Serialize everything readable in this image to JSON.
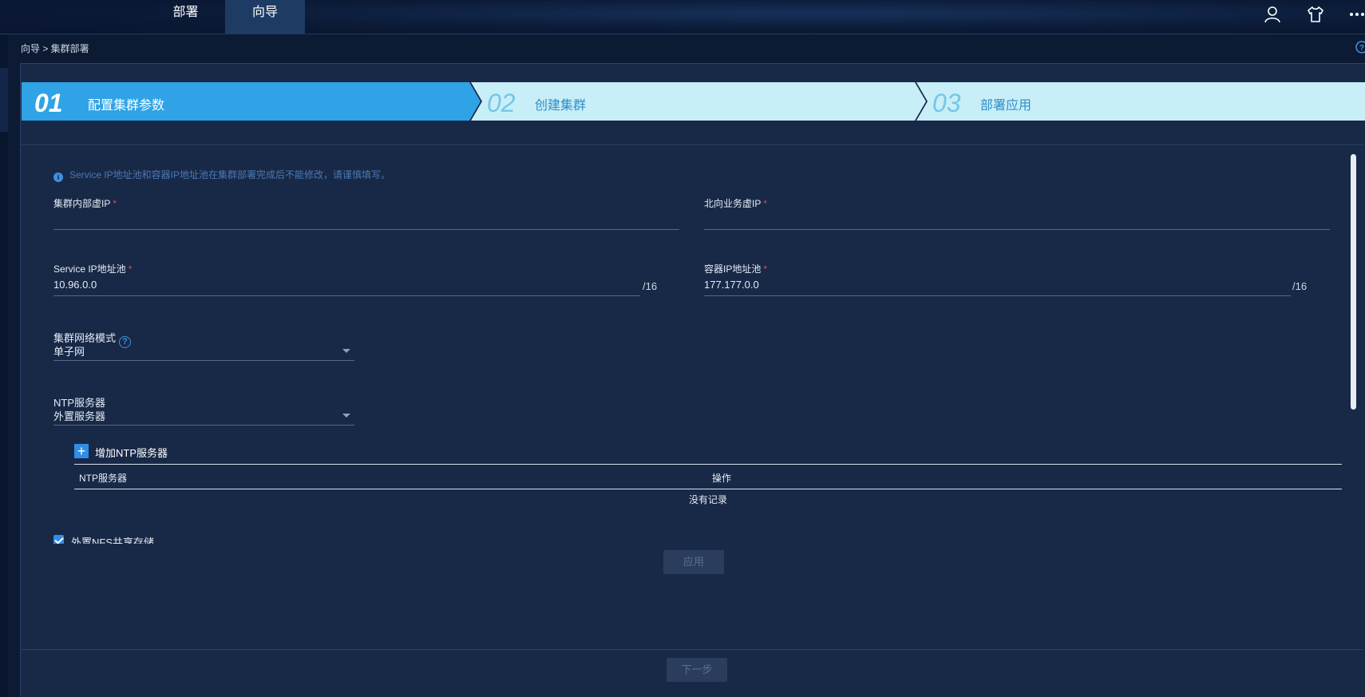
{
  "topbar": {
    "tabs": [
      {
        "label": "部署",
        "active": false
      },
      {
        "label": "向导",
        "active": true
      }
    ],
    "icons": [
      "user-icon",
      "theme-shirt-icon",
      "more-icon"
    ]
  },
  "breadcrumb": {
    "text": "向导 > 集群部署"
  },
  "steps": [
    {
      "number": "01",
      "label": "配置集群参数",
      "active": true
    },
    {
      "number": "02",
      "label": "创建集群",
      "active": false
    },
    {
      "number": "03",
      "label": "部署应用",
      "active": false
    }
  ],
  "form": {
    "notice": "Service IP地址池和容器IP地址池在集群部署完成后不能修改，请谨慎填写。",
    "cluster_vip": {
      "label": "集群内部虚IP",
      "required": "*",
      "value": ""
    },
    "north_vip": {
      "label": "北向业务虚IP",
      "required": "*",
      "value": ""
    },
    "service_pool": {
      "label": "Service IP地址池",
      "required": "*",
      "value": "10.96.0.0",
      "suffix": "/16"
    },
    "container_pool": {
      "label": "容器IP地址池",
      "required": "*",
      "value": "177.177.0.0",
      "suffix": "/16"
    },
    "network_mode": {
      "label": "集群网络模式",
      "help": "?",
      "value": "单子网"
    },
    "ntp_mode": {
      "label": "NTP服务器",
      "value": "外置服务器"
    },
    "add_ntp_label": "增加NTP服务器",
    "ntp_table": {
      "columns": [
        "NTP服务器",
        "操作"
      ],
      "empty_text": "没有记录"
    },
    "nfs_checkbox": {
      "label": "外置NFS共享存储",
      "checked": true
    },
    "apply_button": "应用"
  },
  "footer": {
    "next_button": "下一步"
  },
  "colors": {
    "accent": "#2f8ee6",
    "active_step": "#2fa3e6",
    "inactive_step": "#c8eef8",
    "panel": "#182947"
  }
}
